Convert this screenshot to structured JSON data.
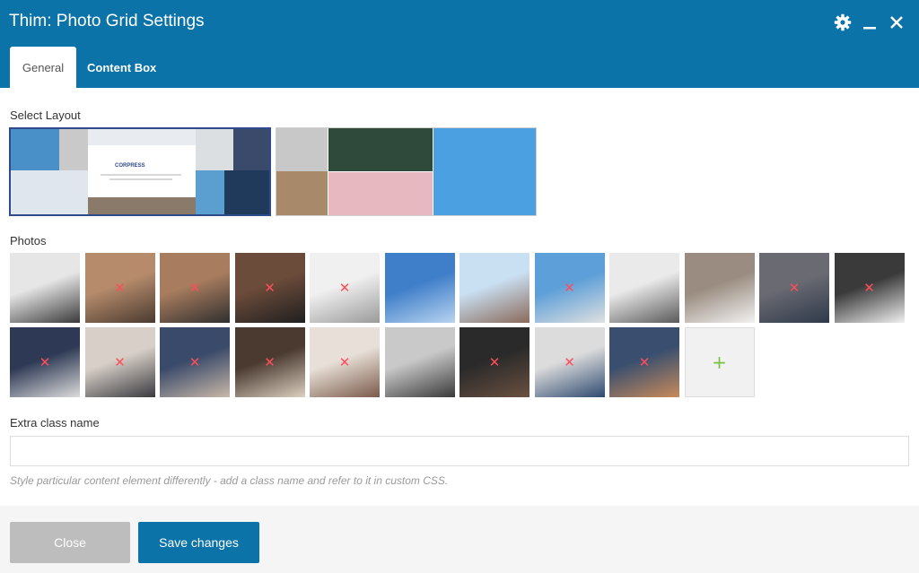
{
  "window": {
    "title": "Thim: Photo Grid Settings",
    "icons": [
      "gear-icon",
      "minimize-icon",
      "close-icon"
    ]
  },
  "tabs": [
    {
      "label": "General",
      "active": true
    },
    {
      "label": "Content Box",
      "active": false
    }
  ],
  "layout": {
    "label": "Select Layout",
    "selected_index": 0,
    "preview_brand": "CORPRESS"
  },
  "photos": {
    "label": "Photos",
    "items": [
      {
        "alt": "business team jumping",
        "removable": false,
        "colors": [
          "#e6e6e6",
          "#3a3a3a"
        ]
      },
      {
        "alt": "office with desks",
        "removable": true,
        "colors": [
          "#b58b6b",
          "#4a3a30"
        ]
      },
      {
        "alt": "open office",
        "removable": true,
        "colors": [
          "#a87c5e",
          "#2f2f2f"
        ]
      },
      {
        "alt": "meeting room",
        "removable": true,
        "colors": [
          "#6b4b3a",
          "#1f1f1f"
        ]
      },
      {
        "alt": "business sketch doodles",
        "removable": true,
        "colors": [
          "#f0f0f0",
          "#9a9a9a"
        ]
      },
      {
        "alt": "modern building by water",
        "removable": false,
        "colors": [
          "#3f7ec9",
          "#b8d4f0"
        ]
      },
      {
        "alt": "house exterior",
        "removable": false,
        "colors": [
          "#c9dff2",
          "#8a6a5a"
        ]
      },
      {
        "alt": "glass office building",
        "removable": true,
        "colors": [
          "#5d9fd8",
          "#e0e0e0"
        ]
      },
      {
        "alt": "handshake",
        "removable": false,
        "colors": [
          "#eaeaea",
          "#5a5a5a"
        ]
      },
      {
        "alt": "man on phone",
        "removable": false,
        "colors": [
          "#9a8c80",
          "#f2f2f2"
        ]
      },
      {
        "alt": "man in vest",
        "removable": true,
        "colors": [
          "#6a6a72",
          "#2e3a4a"
        ]
      },
      {
        "alt": "signing document",
        "removable": true,
        "colors": [
          "#3a3a3a",
          "#f0f0f0"
        ]
      },
      {
        "alt": "businessman at table",
        "removable": true,
        "colors": [
          "#2e3a55",
          "#dcdcdc"
        ]
      },
      {
        "alt": "smiling man at desk",
        "removable": true,
        "colors": [
          "#d8d0c8",
          "#3a3a40"
        ]
      },
      {
        "alt": "team hands on table",
        "removable": true,
        "colors": [
          "#3a4a6a",
          "#c9b8a8"
        ]
      },
      {
        "alt": "meeting over coffee",
        "removable": true,
        "colors": [
          "#4a3a30",
          "#dcd0c0"
        ]
      },
      {
        "alt": "woman in meeting",
        "removable": true,
        "colors": [
          "#e8e0d8",
          "#7a5a4a"
        ]
      },
      {
        "alt": "chess board",
        "removable": false,
        "colors": [
          "#c9c9c9",
          "#3a3a3a"
        ]
      },
      {
        "alt": "businessman hand",
        "removable": true,
        "colors": [
          "#2a2a2a",
          "#6a5040"
        ]
      },
      {
        "alt": "man presenting",
        "removable": true,
        "colors": [
          "#dcdcdc",
          "#2e4a70"
        ]
      },
      {
        "alt": "city bridge at dusk",
        "removable": true,
        "colors": [
          "#3a4f6f",
          "#c98a5a"
        ]
      }
    ],
    "add_symbol": "+",
    "remove_symbol": "✕"
  },
  "extra_class": {
    "label": "Extra class name",
    "value": "",
    "placeholder": "",
    "help": "Style particular content element differently - add a class name and refer to it in custom CSS."
  },
  "footer": {
    "close_label": "Close",
    "save_label": "Save changes"
  },
  "colors": {
    "header": "#0b73a8",
    "selected_border": "#2e4a8b",
    "remove_x": "#ff4d5a",
    "add_plus": "#7ac142"
  }
}
